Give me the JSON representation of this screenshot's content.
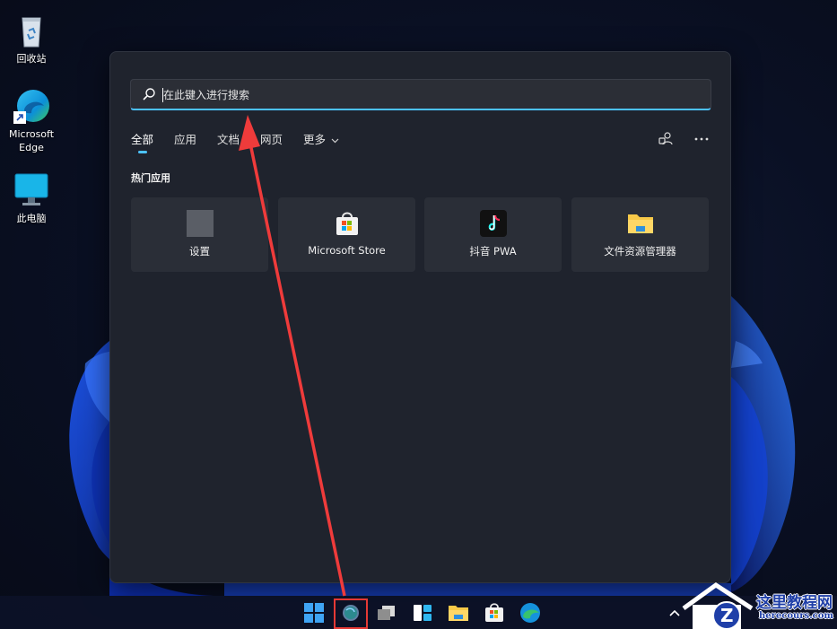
{
  "desktop": {
    "icons": [
      {
        "label": "回收站",
        "icon": "recycle-bin-icon"
      },
      {
        "label": "Microsoft Edge",
        "label_line1": "Microsoft",
        "label_line2": "Edge",
        "icon": "edge-icon"
      },
      {
        "label": "此电脑",
        "icon": "this-pc-icon"
      }
    ]
  },
  "search": {
    "placeholder": "在此键入进行搜索",
    "value": "",
    "accent": "#4cc2ff"
  },
  "tabs": [
    {
      "label": "全部",
      "active": true
    },
    {
      "label": "应用",
      "active": false
    },
    {
      "label": "文档",
      "active": false
    },
    {
      "label": "网页",
      "active": false
    },
    {
      "label": "更多",
      "active": false,
      "has_dropdown": true
    }
  ],
  "tools": [
    {
      "icon": "account-switch-icon"
    },
    {
      "icon": "more-options-icon"
    }
  ],
  "section_title": "热门应用",
  "top_apps": [
    {
      "label": "设置",
      "icon": "settings-icon"
    },
    {
      "label": "Microsoft Store",
      "icon": "store-icon"
    },
    {
      "label": "抖音 PWA",
      "icon": "douyin-icon"
    },
    {
      "label": "文件资源管理器",
      "icon": "folder-icon"
    }
  ],
  "taskbar": {
    "items": [
      {
        "icon": "start-icon"
      },
      {
        "icon": "search-icon",
        "highlighted": true
      },
      {
        "icon": "task-view-icon"
      },
      {
        "icon": "widgets-icon"
      },
      {
        "icon": "file-explorer-icon"
      },
      {
        "icon": "store-icon"
      },
      {
        "icon": "edge-icon"
      }
    ],
    "tray": [
      {
        "icon": "chevron-up-icon"
      }
    ]
  },
  "annotation": {
    "highlight_color": "#e53935"
  },
  "watermark": {
    "line1": "这里教程网",
    "line2": "herecours.com"
  }
}
